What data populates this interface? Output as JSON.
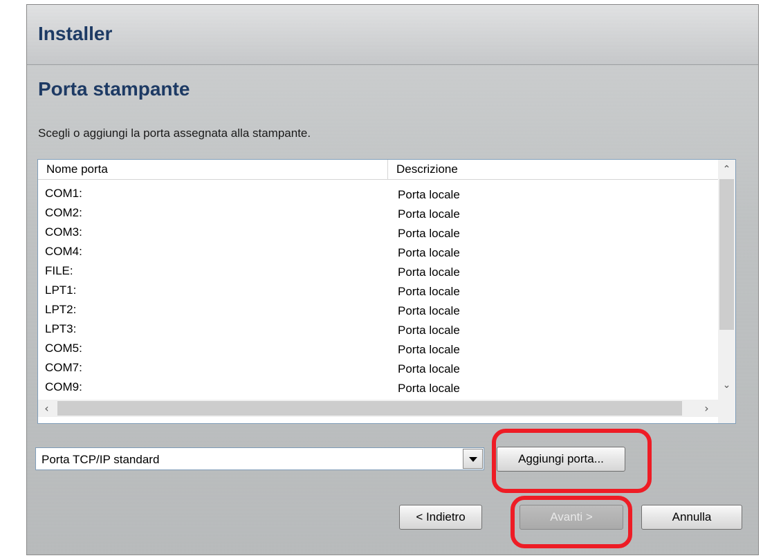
{
  "window": {
    "title": "Installer"
  },
  "page": {
    "heading": "Porta stampante",
    "subtitle": "Scegli o aggiungi la porta assegnata alla stampante."
  },
  "port_list": {
    "columns": [
      "Nome porta",
      "Descrizione"
    ],
    "rows": [
      {
        "name": "COM1:",
        "description": "Porta locale"
      },
      {
        "name": "COM2:",
        "description": "Porta locale"
      },
      {
        "name": "COM3:",
        "description": "Porta locale"
      },
      {
        "name": "COM4:",
        "description": "Porta locale"
      },
      {
        "name": "FILE:",
        "description": "Porta locale"
      },
      {
        "name": "LPT1:",
        "description": "Porta locale"
      },
      {
        "name": "LPT2:",
        "description": "Porta locale"
      },
      {
        "name": "LPT3:",
        "description": "Porta locale"
      },
      {
        "name": "COM5:",
        "description": "Porta locale"
      },
      {
        "name": "COM7:",
        "description": "Porta locale"
      },
      {
        "name": "COM9:",
        "description": "Porta locale"
      }
    ]
  },
  "port_type_select": {
    "selected": "Porta TCP/IP standard"
  },
  "buttons": {
    "add_port": "Aggiungi porta...",
    "back": "< Indietro",
    "next": "Avanti >",
    "cancel": "Annulla"
  },
  "colors": {
    "heading": "#1d3a64",
    "highlight": "#ee1c25"
  }
}
